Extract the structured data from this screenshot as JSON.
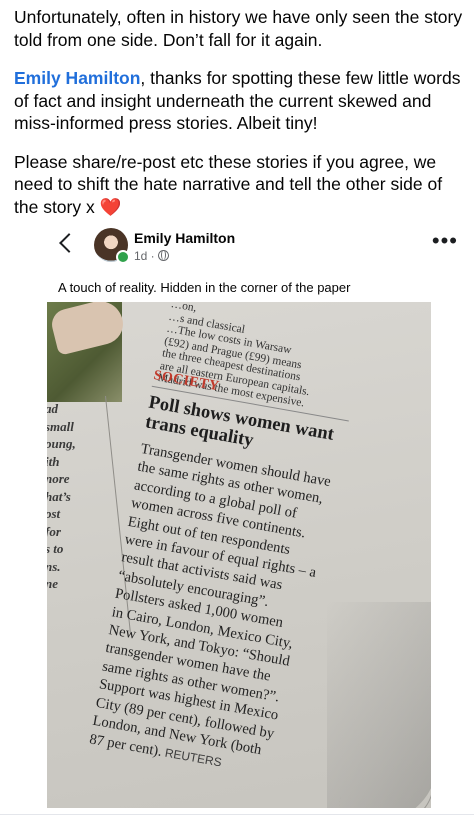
{
  "post": {
    "paragraph1": "Unfortunately, often in history we have only seen the story told from one side. Don’t fall for it again.",
    "mention_name": "Emily Hamilton",
    "paragraph2_rest": ", thanks for spotting these few little words of fact and insight underneath the current skewed and miss-informed press stories. Albeit tiny!",
    "paragraph3": "Please share/re-post etc these stories if you agree, we need to shift the hate narrative and tell the other side of the story x",
    "heart_emoji": "❤️"
  },
  "shared_post": {
    "author": "Emily Hamilton",
    "time": "1d ·",
    "more": "•••",
    "caption": "A touch of reality.  Hidden in the corner of the paper"
  },
  "newspaper": {
    "top_snippet": [
      "…on,",
      "…s and classical",
      "…The low costs in Warsaw",
      "(£92) and Prague (£99) means",
      "the three cheapest destinations",
      "are all eastern European capitals.",
      "Madrid was the most expensive."
    ],
    "left_column": [
      "ad small",
      "oung,",
      "ith",
      "nore",
      "hat’s",
      "ost",
      "for",
      "s to",
      "ns.",
      "ne"
    ],
    "section": "SOCIETY",
    "headline": "Poll shows women want trans equality",
    "body_lines": [
      "Transgender women should have",
      "the same rights as other women,",
      "according to a global poll of",
      "women across five continents.",
      "Eight out of ten respondents",
      "were in favour of equal rights – a",
      "result that activists said was",
      "“absolutely encouraging”.",
      "Pollsters asked 1,000 women",
      "in Cairo, London, Mexico City,",
      "New York, and Tokyo: “Should",
      "transgender women have the",
      "same rights as other women?”.",
      "Support was highest in Mexico",
      "City (89 per cent), followed by",
      "London, and New York (both",
      "87 per cent)."
    ],
    "credit": "REUTERS"
  }
}
